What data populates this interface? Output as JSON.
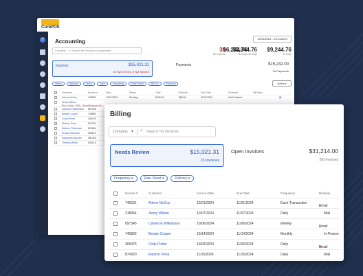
{
  "app": {
    "logo_text": "CurbPOS"
  },
  "accounting": {
    "title": "Accounting",
    "date_range": "12/14/2023 - 01/14/2024",
    "search_scope": "Contains",
    "search_placeholder": "Search for invoices or payments",
    "stats": [
      {
        "value": "30",
        "label": "Not Synced",
        "highlight": true
      },
      {
        "value": "$2,244.76",
        "label": "30 Days",
        "highlight": false
      },
      {
        "value": "$6,244.76",
        "label": "60 Days",
        "highlight": false
      },
      {
        "value": "$9,244.76",
        "label": "90 Days",
        "highlight": false
      }
    ],
    "invoices_card": {
      "title": "Invoices",
      "amount": "$15,021.31",
      "errors": "26 Sync Errors, 8 Not Synced"
    },
    "payments_card": {
      "title": "Payments",
      "amount": "$15,232.00",
      "count": "24 Payments"
    },
    "filters": [
      "Status",
      "Balance",
      "Terms",
      "Type",
      "Frequency",
      "Rate Sheet",
      "Bill Src",
      "Products"
    ],
    "actions_label": "Actions",
    "columns": [
      "Customer",
      "Invoice #",
      "Date",
      "Status",
      "Total",
      "Balance",
      "Due Date",
      "Finalized",
      "QB Sync"
    ],
    "rows": [
      {
        "customer": "Arlene McCoy",
        "invoice": "745631",
        "date": "10/01/2024",
        "status": "Pending",
        "total": "$109.00",
        "balance": "$89.00",
        "due": "11/01/2024",
        "finalized": "Not Finalized",
        "error": ""
      },
      {
        "customer": "Jenny Wilson",
        "invoice": "",
        "date": "",
        "status": "",
        "total": "",
        "balance": "",
        "due": "",
        "finalized": "",
        "error": "Error Code: 2300 - Something you're t"
      },
      {
        "customer": "Cameron Williamson",
        "invoice": "897345",
        "date": "",
        "status": "",
        "total": "",
        "balance": "",
        "due": "",
        "finalized": "",
        "error": ""
      },
      {
        "customer": "Bessie Cooper",
        "invoice": "745892",
        "date": "",
        "status": "",
        "total": "",
        "balance": "",
        "due": "",
        "finalized": "",
        "error": ""
      },
      {
        "customer": "Cody Fisher",
        "invoice": "309476",
        "date": "",
        "status": "",
        "total": "",
        "balance": "",
        "due": "",
        "finalized": "",
        "error": ""
      },
      {
        "customer": "Eleanor Pena",
        "invoice": "874320",
        "date": "",
        "status": "",
        "total": "",
        "balance": "",
        "due": "",
        "finalized": "",
        "error": ""
      },
      {
        "customer": "Darlene Robertson",
        "invoice": "821564",
        "date": "",
        "status": "",
        "total": "",
        "balance": "",
        "due": "",
        "finalized": "",
        "error": ""
      },
      {
        "customer": "Ronald Richards",
        "invoice": "964872",
        "date": "",
        "status": "",
        "total": "",
        "balance": "",
        "due": "",
        "finalized": "",
        "error": ""
      },
      {
        "customer": "Savannah Nguyen",
        "invoice": "381254",
        "date": "",
        "status": "",
        "total": "",
        "balance": "",
        "due": "",
        "finalized": "",
        "error": ""
      },
      {
        "customer": "Theresa Webb",
        "invoice": "546219",
        "date": "",
        "status": "",
        "total": "",
        "balance": "",
        "due": "",
        "finalized": "",
        "error": ""
      }
    ]
  },
  "billing": {
    "title": "Billing",
    "search_scope": "Contains",
    "search_placeholder": "Search for invoices",
    "needs_review": {
      "title": "Needs Review",
      "amount": "$15,021.31",
      "count": "15 invoices"
    },
    "open_invoices": {
      "title": "Open Invoices",
      "amount": "$31,214.00",
      "count": "58 invoices"
    },
    "filters": [
      "Frequency",
      "Rate Sheet",
      "Delivery"
    ],
    "columns": [
      "Invoice #",
      "Customer",
      "Invoice Date",
      "Due Date",
      "Frequency",
      "Delivery"
    ],
    "rows": [
      {
        "invoice": "745631",
        "customer": "Arlene McCoy",
        "invoice_date": "10/01/2024",
        "due": "11/01/2024",
        "frequency": "Each Transaction",
        "delivery": "Email",
        "delivery_icon": "check-icon"
      },
      {
        "invoice": "318954",
        "customer": "Jenny Wilson",
        "invoice_date": "10/07/2024",
        "due": "11/07/2024",
        "frequency": "Daily",
        "delivery": "Mail",
        "delivery_icon": ""
      },
      {
        "invoice": "897345",
        "customer": "Cameron Williamson",
        "invoice_date": "10/06/2024",
        "due": "11/06/2024",
        "frequency": "Weekly",
        "delivery": "Email",
        "delivery_icon": "check-icon"
      },
      {
        "invoice": "745892",
        "customer": "Bessie Cooper",
        "invoice_date": "10/14/2024",
        "due": "11/14/2024",
        "frequency": "Monthly",
        "delivery": "In-Person",
        "delivery_icon": ""
      },
      {
        "invoice": "309476",
        "customer": "Cody Fisher",
        "invoice_date": "10/02/2024",
        "due": "11/02/2024",
        "frequency": "Daily",
        "delivery": "Email",
        "delivery_icon": "x-icon"
      },
      {
        "invoice": "874320",
        "customer": "Eleanor Pena",
        "invoice_date": "11/15/2024",
        "due": "11/15/2024",
        "frequency": "Daily",
        "delivery": "Mail",
        "delivery_icon": ""
      }
    ]
  }
}
